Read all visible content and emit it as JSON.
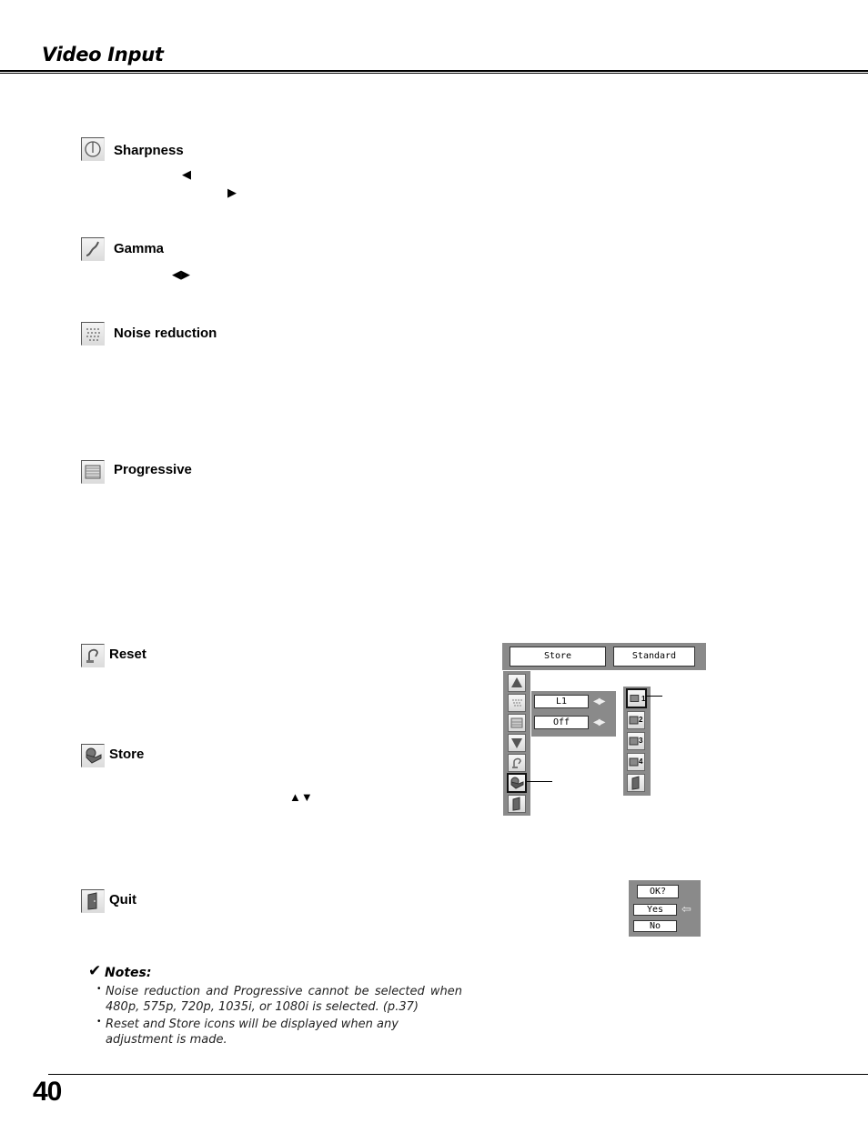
{
  "header": {
    "title": "Video Input"
  },
  "sections": {
    "sharpness": {
      "label": "Sharpness",
      "arrow_left": "◀",
      "arrow_right": "▶"
    },
    "gamma": {
      "label": "Gamma",
      "arrows": "◀▶"
    },
    "noise_reduction": {
      "label": "Noise reduction"
    },
    "progressive": {
      "label": "Progressive"
    },
    "reset": {
      "label": "Reset"
    },
    "store": {
      "label": "Store",
      "arrows": "▲▼"
    },
    "quit": {
      "label": "Quit"
    }
  },
  "osd_store": {
    "title_left": "Store",
    "title_right": "Standard",
    "left_icons": [
      "up-arrow-icon",
      "noise-reduction-icon",
      "progressive-icon",
      "down-arrow-icon",
      "reset-icon",
      "store-icon",
      "quit-icon"
    ],
    "selected_left": "store-icon",
    "rows": [
      {
        "value": "L1",
        "arrows": "◀▶"
      },
      {
        "value": "Off",
        "arrows": "◀▶"
      }
    ],
    "slots": [
      {
        "label": "1",
        "selected": true
      },
      {
        "label": "2",
        "selected": false
      },
      {
        "label": "3",
        "selected": false
      },
      {
        "label": "4",
        "selected": false
      }
    ],
    "slot_exit_icon": "quit-icon"
  },
  "osd_quit": {
    "prompt": "OK?",
    "yes": "Yes",
    "no": "No",
    "pointer": "⇦"
  },
  "notes": {
    "check": "✔",
    "title": "Notes:",
    "items": [
      "Noise reduction and Progressive cannot be selected when 480p, 575p, 720p, 1035i, or 1080i is selected.  (p.37)",
      "Reset and Store icons will be displayed when any adjustment is made."
    ]
  },
  "footer": {
    "page_number": "40"
  }
}
